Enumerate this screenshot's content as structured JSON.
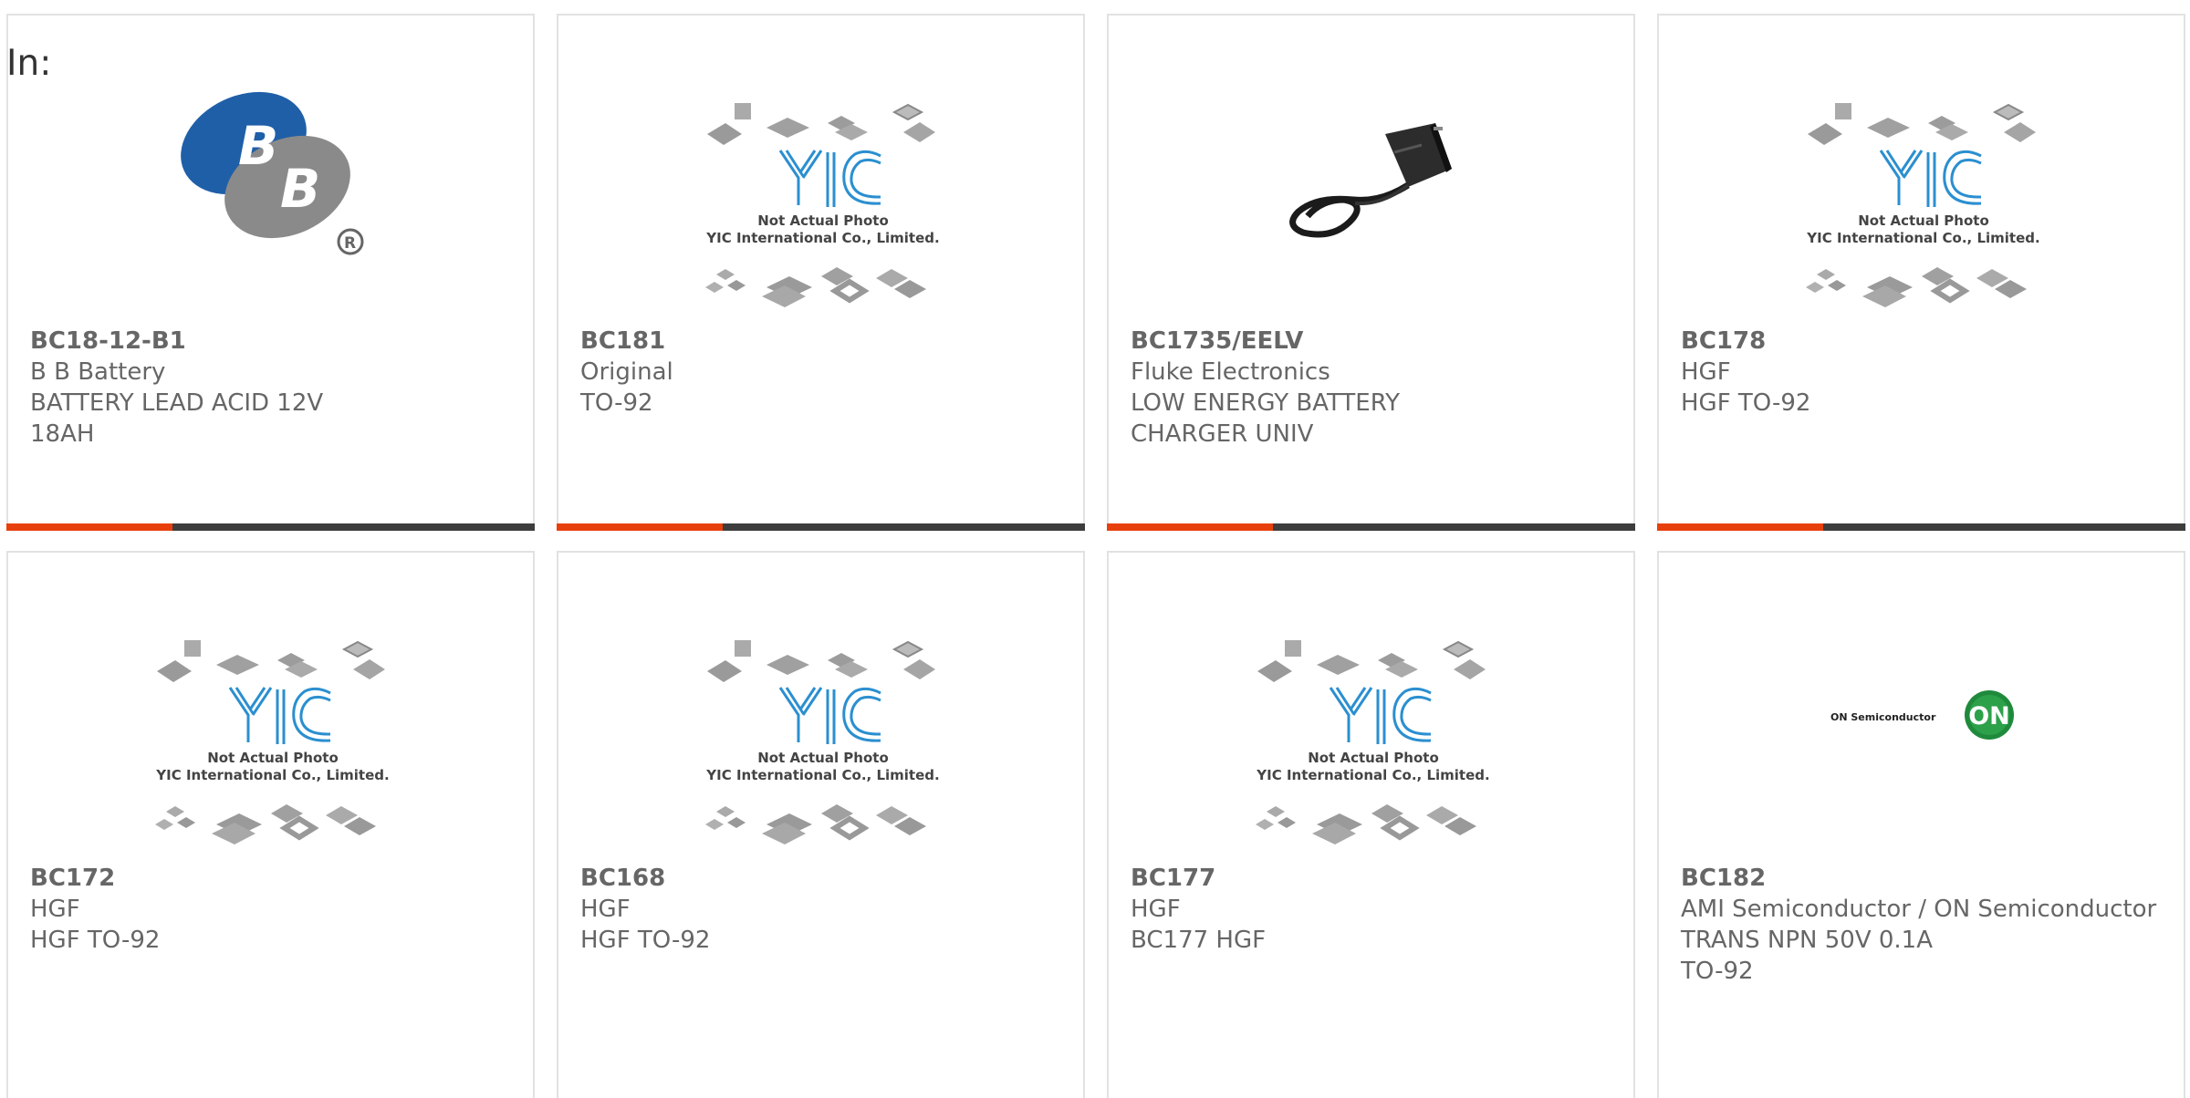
{
  "header": {
    "in_label": "In:"
  },
  "colors": {
    "accent": "#e8400c",
    "bar": "#3d3d3d",
    "text": "#666666",
    "border": "#e2e2e2"
  },
  "placeholder": {
    "line1": "Not Actual Photo",
    "line2": "YIC International Co., Limited."
  },
  "on_logo": {
    "text": "ON Semiconductor",
    "badge": "ON"
  },
  "products": [
    {
      "pn": "BC18-12-B1",
      "mfr": "B B Battery",
      "desc": "BATTERY LEAD ACID 12V 18AH",
      "image": "bb-battery-logo"
    },
    {
      "pn": "BC181",
      "mfr": "Original",
      "desc": "TO-92",
      "image": "yic-placeholder"
    },
    {
      "pn": "BC1735/EELV",
      "mfr": "Fluke Electronics",
      "desc": "LOW ENERGY BATTERY CHARGER UNIV",
      "image": "charger-photo"
    },
    {
      "pn": "BC178",
      "mfr": "HGF",
      "desc": "HGF TO-92",
      "image": "yic-placeholder"
    },
    {
      "pn": "BC172",
      "mfr": "HGF",
      "desc": "HGF TO-92",
      "image": "yic-placeholder"
    },
    {
      "pn": "BC168",
      "mfr": "HGF",
      "desc": "HGF TO-92",
      "image": "yic-placeholder"
    },
    {
      "pn": "BC177",
      "mfr": "HGF",
      "desc": "BC177 HGF",
      "image": "yic-placeholder"
    },
    {
      "pn": "BC182",
      "mfr": "AMI Semiconductor / ON Semiconductor",
      "desc": "TRANS NPN 50V 0.1A TO-92",
      "image": "on-semiconductor-logo"
    }
  ]
}
